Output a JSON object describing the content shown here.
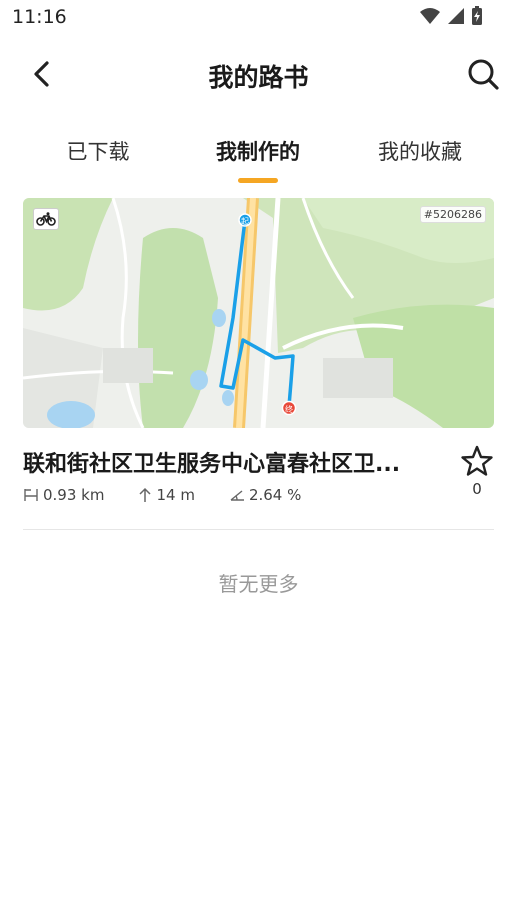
{
  "status_bar": {
    "time": "11:16"
  },
  "header": {
    "title": "我的路书"
  },
  "tabs": [
    {
      "label": "已下载",
      "active": false
    },
    {
      "label": "我制作的",
      "active": true
    },
    {
      "label": "我的收藏",
      "active": false
    }
  ],
  "route": {
    "id_label": "#5206286",
    "title": "联和街社区卫生服务中心富春社区卫...",
    "distance": "0.93 km",
    "elevation_gain": "14 m",
    "grade": "2.64 %",
    "favorites": "0",
    "start_marker": "起",
    "end_marker": "终"
  },
  "footer": {
    "no_more": "暂无更多"
  },
  "colors": {
    "accent": "#f5a623",
    "route_line": "#1aa0e8",
    "start": "#1aa0e8",
    "end": "#e84a3a"
  }
}
